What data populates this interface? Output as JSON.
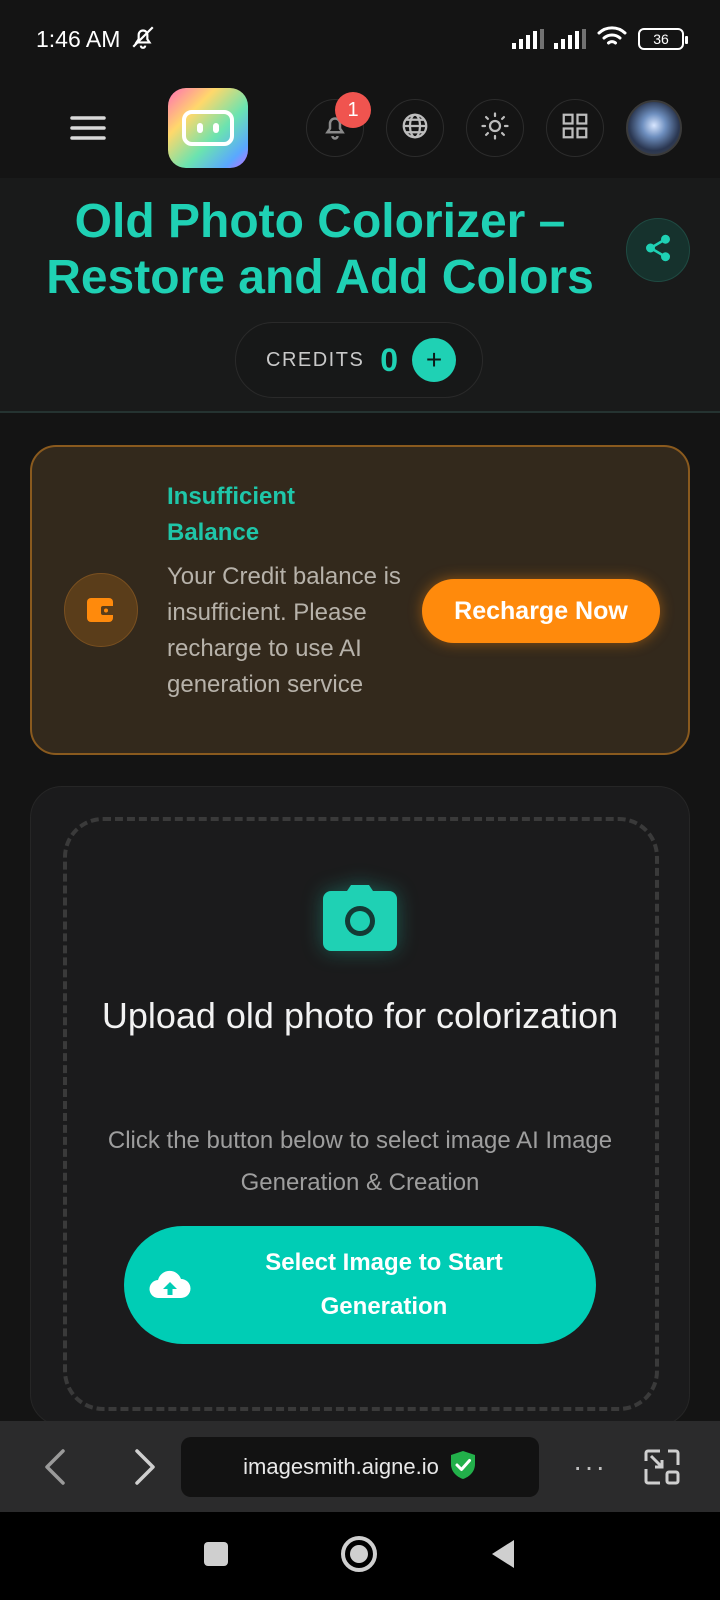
{
  "status_bar": {
    "time": "1:46 AM",
    "battery": "36",
    "icons": [
      "bell-off-icon",
      "signal-icon",
      "signal-icon",
      "wifi-icon",
      "battery-icon"
    ]
  },
  "header": {
    "menu_icon": "hamburger-menu-icon",
    "logo_icon": "app-logo-icon",
    "notification_count": "1",
    "icons": [
      "bell-icon",
      "globe-icon",
      "sun-icon",
      "grid-icon",
      "avatar"
    ]
  },
  "page": {
    "title": "Old Photo Colorizer – Restore and Add Colors",
    "share_icon": "share-icon"
  },
  "credits": {
    "label": "CREDITS",
    "value": "0",
    "add_symbol": "+"
  },
  "balance_alert": {
    "title": "Insufficient Balance",
    "message": "Your Credit balance is insufficient. Please recharge to use AI generation service",
    "button_label": "Recharge Now",
    "icon": "wallet-icon"
  },
  "upload": {
    "icon": "camera-icon",
    "title": "Upload old photo for colorization",
    "subtitle": "Click the button below to select image AI Image Generation & Creation",
    "button_label": "Select Image to Start Generation",
    "button_icon": "cloud-upload-icon"
  },
  "browser_bar": {
    "url": "imagesmith.aigne.io",
    "more_label": "···",
    "icons": [
      "back-arrow-icon",
      "forward-arrow-icon",
      "shield-check-icon",
      "resize-icon"
    ]
  },
  "system_nav": {
    "icons": [
      "recents-square-icon",
      "home-circle-icon",
      "back-triangle-icon"
    ]
  },
  "colors": {
    "accent": "#1fd1b4",
    "button_teal": "#00cdb5",
    "warning": "#ff8a0c",
    "background": "#141414"
  }
}
